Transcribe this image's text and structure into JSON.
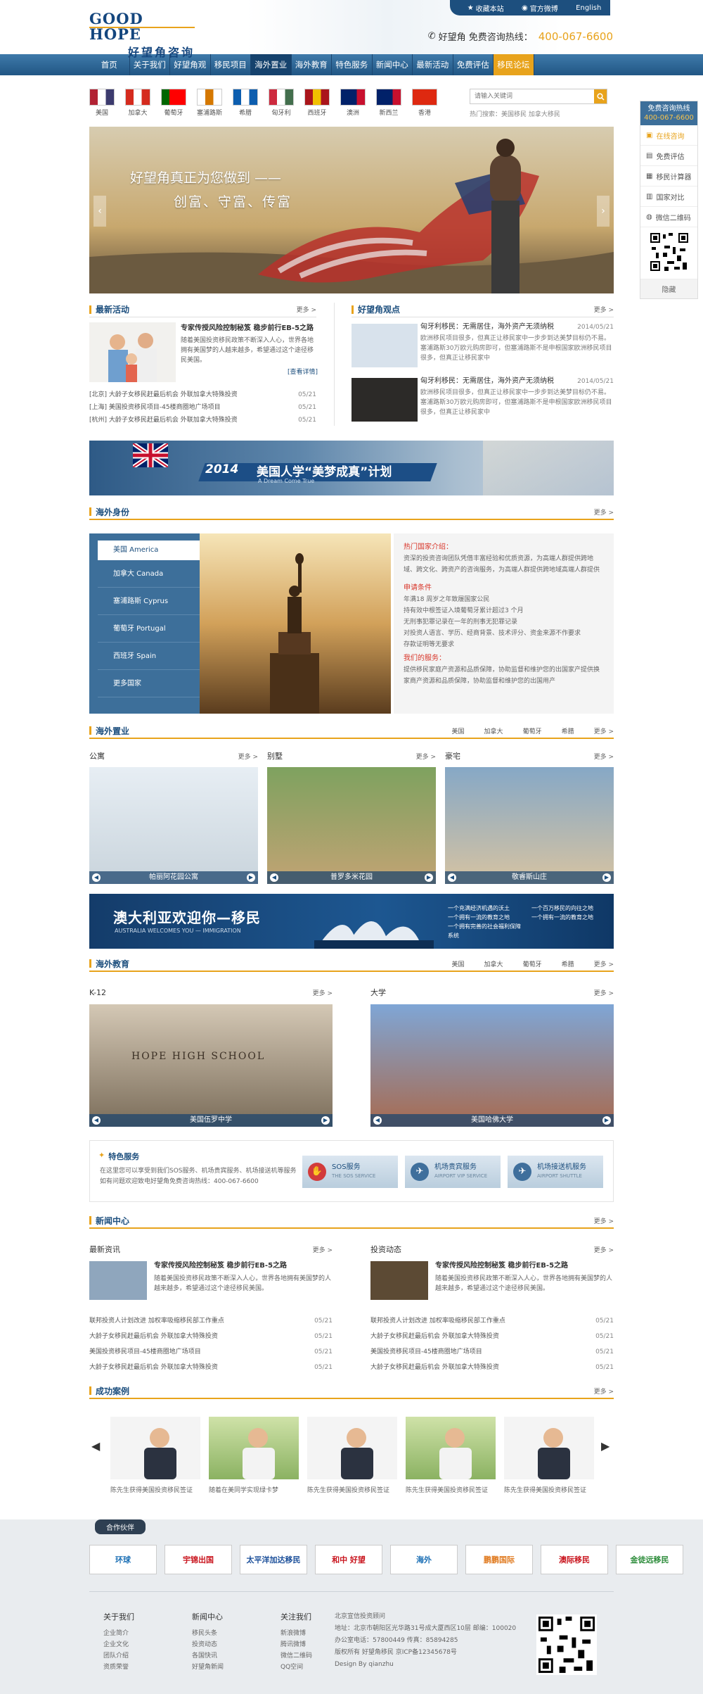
{
  "header": {
    "logo_en": "GOOD HOPE",
    "logo_cn": "好望角咨询",
    "top_links": [
      "收藏本站",
      "官方微博",
      "English"
    ],
    "hotline_label": "好望角 免费咨询热线：",
    "hotline_number": "400-067-6600"
  },
  "nav": [
    "首页",
    "关于我们",
    "好望角观点",
    "移民项目",
    "海外置业",
    "海外教育",
    "特色服务",
    "新闻中心",
    "最新活动",
    "免费评估",
    "移民论坛"
  ],
  "flags": [
    {
      "name": "美国",
      "colors": [
        "#b22234",
        "#ffffff",
        "#3c3b6e"
      ]
    },
    {
      "name": "加拿大",
      "colors": [
        "#d52b1e",
        "#ffffff",
        "#d52b1e"
      ]
    },
    {
      "name": "葡萄牙",
      "colors": [
        "#006600",
        "#ff0000",
        "#ff0000"
      ]
    },
    {
      "name": "塞浦路斯",
      "colors": [
        "#ffffff",
        "#d57800",
        "#ffffff"
      ]
    },
    {
      "name": "希腊",
      "colors": [
        "#0d5eaf",
        "#ffffff",
        "#0d5eaf"
      ]
    },
    {
      "name": "匈牙利",
      "colors": [
        "#cd2a3e",
        "#ffffff",
        "#436f4d"
      ]
    },
    {
      "name": "西班牙",
      "colors": [
        "#aa151b",
        "#f1bf00",
        "#aa151b"
      ]
    },
    {
      "name": "澳洲",
      "colors": [
        "#012169",
        "#012169",
        "#c8102e"
      ]
    },
    {
      "name": "新西兰",
      "colors": [
        "#012169",
        "#012169",
        "#c8102e"
      ]
    },
    {
      "name": "香港",
      "colors": [
        "#de2910",
        "#de2910",
        "#de2910"
      ]
    }
  ],
  "search": {
    "placeholder": "请输入关键词",
    "hot": "热门搜索：美国移民  加拿大移民"
  },
  "side": {
    "head_line1": "免费咨询热线",
    "head_line2": "400-067-6600",
    "items": [
      "在线咨询",
      "免费评估",
      "移民计算器",
      "国家对比",
      "微信二维码"
    ],
    "hide": "隐藏"
  },
  "banner": {
    "line1": "好望角真正为您做到 ——",
    "line2": "创富、守富、传富"
  },
  "latest": {
    "title": "最新活动",
    "more": "更多 >",
    "feature_title": "专家传授风险控制秘笈 稳步前行EB-5之路",
    "feature_text": "随着美国投资移民政策不断深入人心，世界各地拥有美国梦的人越来越多，希望通过这个途径移民美国。",
    "feature_link": "[查看详情]",
    "items": [
      {
        "t": "[北京] 大龄子女移民赶最后机会 外联加拿大特殊投资",
        "d": "05/21"
      },
      {
        "t": "[上海] 美国投资移民项目-45楼商圈地广场项目",
        "d": "05/21"
      },
      {
        "t": "[杭州] 大龄子女移民赶最后机会 外联加拿大特殊投资",
        "d": "05/21"
      }
    ]
  },
  "views": {
    "title": "好望角观点",
    "more": "更多 >",
    "items": [
      {
        "t": "匈牙利移民：无需居住，海外资产无须纳税",
        "d": "2014/05/21",
        "x": "欧洲移民项目很多，但真正让移民家中一步步到达美梦目标仍不易。塞浦路斯30万欧元购房即可，但塞浦路斯不是申根国家欧洲移民项目很多，但真正让移民家中"
      },
      {
        "t": "匈牙利移民：无需居住，海外资产无须纳税",
        "d": "2014/05/21",
        "x": "欧洲移民项目很多，但真正让移民家中一步步到达美梦目标仍不易。塞浦路斯30万欧元购房即可，但塞浦路斯不是申根国家欧洲移民项目很多，但真正让移民家中"
      }
    ]
  },
  "ad1": {
    "year": "2014",
    "text": "美国人学“美梦成真”计划",
    "sub": "A Dream Come True"
  },
  "identity": {
    "title": "海外身份",
    "more": "更多 >",
    "countries": [
      "美国 America",
      "加拿大 Canada",
      "塞浦路斯 Cyprus",
      "葡萄牙 Portugal",
      "西班牙 Spain",
      "更多国家"
    ],
    "hot_title": "热门国家介绍：",
    "hot_text": "资深的投资咨询团队凭借丰富经验和优质资源，为高端人群提供跨地域、跨文化、跨资产的咨询服务，为高端人群提供跨地域高端人群提供",
    "cond_title": "申请条件",
    "conds": [
      "年满18 周岁之年致履国家公民",
      "持有效中根签证入境葡萄牙累计超过3 个月",
      "无刑事犯罪记录在一年的刑事无犯罪记录",
      "对投资人语言、学历、经商背景、技术评分、资金来源不作要求",
      "存款证明等无要求"
    ],
    "svc_title": "我们的服务：",
    "svc_text": "提供移民家庭产资源和品质保障，协助监督和维护您的出国家产提供换家商产资源和品质保障，协助监督和维护您的出国用产"
  },
  "property": {
    "title": "海外置业",
    "tabs": [
      "美国",
      "加拿大",
      "葡萄牙",
      "希腊"
    ],
    "more": "更多 >",
    "cols": [
      {
        "title": "公寓",
        "more": "更多 >",
        "caption": "帕丽阿花园公寓"
      },
      {
        "title": "别墅",
        "more": "更多 >",
        "caption": "普罗多米花园"
      },
      {
        "title": "豪宅",
        "more": "更多 >",
        "caption": "敬睿斯山庄"
      }
    ]
  },
  "ad2": {
    "text": "澳大利亚欢迎你—移民",
    "sub": "AUSTRALIA WELCOMES YOU — IMMIGRATION",
    "right": [
      "一个充满经济机遇的沃土",
      "一个拥有一流的教育之地",
      "一个拥有完善的社会福利保障系统",
      "一个百万移民的向往之地",
      "一个拥有一流的教育之地"
    ]
  },
  "education": {
    "title": "海外教育",
    "tabs": [
      "美国",
      "加拿大",
      "葡萄牙",
      "希腊"
    ],
    "more": "更多 >",
    "cols": [
      {
        "title": "K-12",
        "more": "更多 >",
        "caption": "美国伍罗中学",
        "sign": "HOPE HIGH SCHOOL"
      },
      {
        "title": "大学",
        "more": "更多 >",
        "caption": "美国哈佛大学"
      }
    ]
  },
  "special": {
    "title": "特色服务",
    "text": "在这里您可以享受到我们SOS服务、机场贵宾服务、机场接送机等服务 如有问题欢迎致电好望角免费咨询热线：400-067-6600",
    "buttons": [
      {
        "label": "SOS服务",
        "sub": "THE SOS SERVICE"
      },
      {
        "label": "机场贵宾服务",
        "sub": "AIRPORT VIP SERVICE"
      },
      {
        "label": "机场接送机服务",
        "sub": "AIRPORT SHUTTLE"
      }
    ]
  },
  "news": {
    "title": "新闻中心",
    "more": "更多 >",
    "cols": [
      {
        "title": "最新资讯",
        "more": "更多 >",
        "feature_title": "专家传授风险控制秘笈 稳步前行EB-5之路",
        "feature_text": "随着美国投资移民政策不断深入人心，世界各地拥有美国梦的人越来越多，希望通过这个途径移民美国。",
        "items": [
          {
            "t": "联邦投资人计划改进 加权率吸缩移民部工作重点",
            "d": "05/21"
          },
          {
            "t": "大龄子女移民赶最后机会 外联加拿大特殊投资",
            "d": "05/21"
          },
          {
            "t": "美国投资移民项目-45楼商圈地广场项目",
            "d": "05/21"
          },
          {
            "t": "大龄子女移民赶最后机会 外联加拿大特殊投资",
            "d": "05/21"
          }
        ]
      },
      {
        "title": "投资动态",
        "more": "更多 >",
        "feature_title": "专家传授风险控制秘笈 稳步前行EB-5之路",
        "feature_text": "随着美国投资移民政策不断深入人心，世界各地拥有美国梦的人越来越多，希望通过这个途径移民美国。",
        "items": [
          {
            "t": "联邦投资人计划改进 加权率吸缩移民部工作重点",
            "d": "05/21"
          },
          {
            "t": "大龄子女移民赶最后机会 外联加拿大特殊投资",
            "d": "05/21"
          },
          {
            "t": "美国投资移民项目-45楼商圈地广场项目",
            "d": "05/21"
          },
          {
            "t": "大龄子女移民赶最后机会 外联加拿大特殊投资",
            "d": "05/21"
          }
        ]
      }
    ]
  },
  "cases": {
    "title": "成功案例",
    "more": "更多 >",
    "items": [
      "陈先生获得美国投资移民签证",
      "随着在美同学实现绿卡梦",
      "陈先生获得美国投资移民签证",
      "陈先生获得美国投资移民签证",
      "陈先生获得美国投资移民签证"
    ]
  },
  "partners": {
    "label": "合作伙伴",
    "logos": [
      {
        "name": "环球",
        "color": "#1b6fb5"
      },
      {
        "name": "宇锦出国",
        "color": "#c9151e"
      },
      {
        "name": "太平洋加达移民",
        "color": "#1b4f9a"
      },
      {
        "name": "和中 好望",
        "color": "#c9151e"
      },
      {
        "name": "海外",
        "color": "#1b6fb5"
      },
      {
        "name": "鹏鹏国际",
        "color": "#e07a1f"
      },
      {
        "name": "澳际移民",
        "color": "#c9151e"
      },
      {
        "name": "金徒远移民",
        "color": "#2c8c3a"
      }
    ]
  },
  "footer": {
    "cols": [
      {
        "title": "关于我们",
        "items": [
          "企业简介",
          "企业文化",
          "团队介绍",
          "资质荣誉"
        ]
      },
      {
        "title": "新闻中心",
        "items": [
          "移民头条",
          "投资动态",
          "各国快讯",
          "好望角新闻"
        ]
      },
      {
        "title": "关注我们",
        "items": [
          "新浪微博",
          "腾讯微博",
          "微信二维码",
          "QQ空间"
        ]
      }
    ],
    "company": "北京宣信投资顾问",
    "info": [
      "地址：北京市朝阳区光华路31号成大厦西区10层 邮编：100020",
      "办公室电话：57800449 传真：85894285",
      "版权所有 好望角移民 京ICP备12345678号",
      "Design By qianzhu"
    ]
  }
}
